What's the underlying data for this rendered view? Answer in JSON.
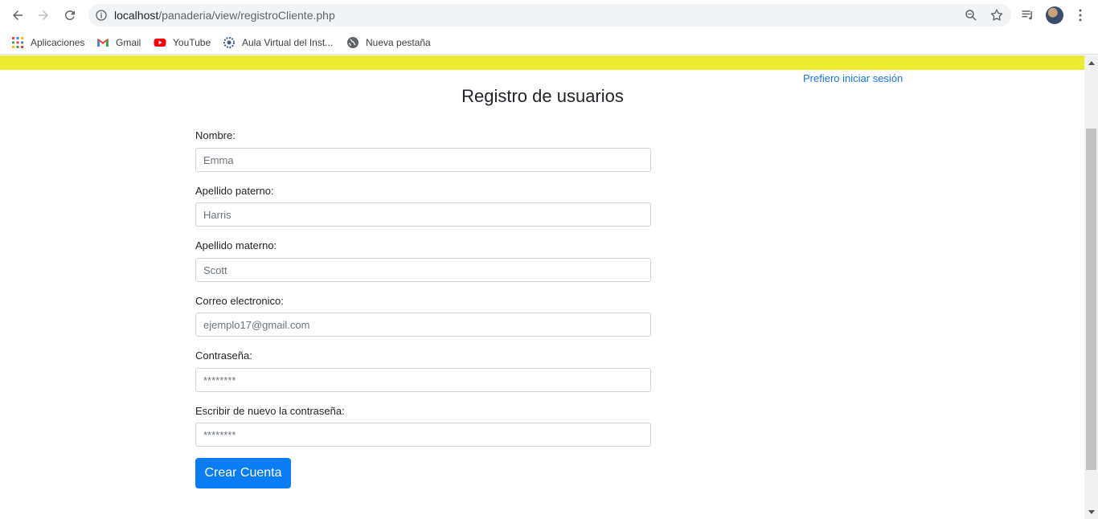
{
  "browser": {
    "url_host": "localhost",
    "url_path": "/panaderia/view/registroCliente.php"
  },
  "bookmarks": [
    {
      "label": "Aplicaciones",
      "icon": "apps-grid-icon"
    },
    {
      "label": "Gmail",
      "icon": "gmail-icon"
    },
    {
      "label": "YouTube",
      "icon": "youtube-icon"
    },
    {
      "label": "Aula Virtual del Inst...",
      "icon": "moodle-icon"
    },
    {
      "label": "Nueva pestaña",
      "icon": "globe-icon"
    }
  ],
  "page": {
    "login_link": "Prefiero iniciar sesión",
    "title": "Registro de usuarios",
    "fields": [
      {
        "label": "Nombre:",
        "placeholder": "Emma"
      },
      {
        "label": "Apellido paterno:",
        "placeholder": "Harris"
      },
      {
        "label": "Apellido materno:",
        "placeholder": "Scott"
      },
      {
        "label": "Correo electronico:",
        "placeholder": "ejemplo17@gmail.com"
      },
      {
        "label": "Contraseña:",
        "placeholder": "********"
      },
      {
        "label": "Escribir de nuevo la contraseña:",
        "placeholder": "********"
      }
    ],
    "submit_label": "Crear Cuenta"
  },
  "colors": {
    "header_yellow": "#ebeb32",
    "button_blue": "#0a7cf4",
    "link_blue": "#1a73e8"
  }
}
